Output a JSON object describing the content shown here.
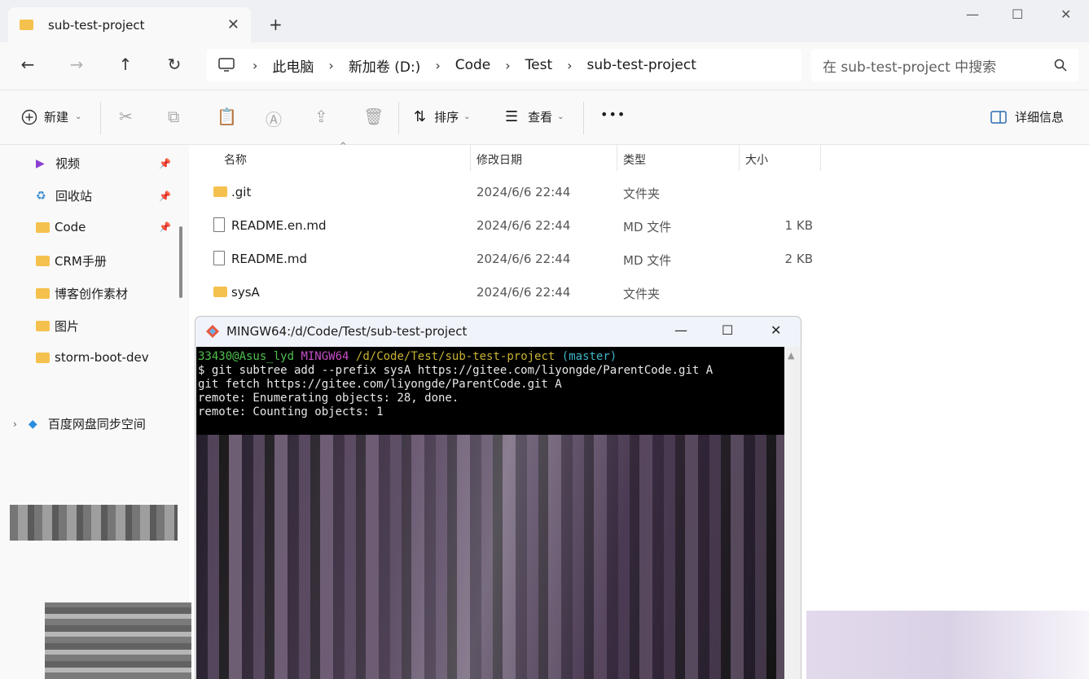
{
  "tab": {
    "title": "sub-test-project",
    "close": "✕"
  },
  "new_tab": "+",
  "window_controls": {
    "minimize": "—",
    "maximize": "☐",
    "close": "✕"
  },
  "nav": {
    "back": "←",
    "forward": "→",
    "up": "↑",
    "refresh": "↻"
  },
  "breadcrumb": [
    "此电脑",
    "新加卷 (D:)",
    "Code",
    "Test",
    "sub-test-project"
  ],
  "search": {
    "placeholder": "在 sub-test-project 中搜索"
  },
  "toolbar": {
    "new_label": "新建",
    "sort_label": "排序",
    "view_label": "查看",
    "more_label": "•••",
    "details_label": "详细信息"
  },
  "sidebar": {
    "items": [
      {
        "label": "视频",
        "pinned": true
      },
      {
        "label": "回收站",
        "pinned": true
      },
      {
        "label": "Code",
        "pinned": true
      },
      {
        "label": "CRM手册",
        "pinned": false
      },
      {
        "label": "博客创作素材",
        "pinned": false
      },
      {
        "label": "图片",
        "pinned": false
      },
      {
        "label": "storm-boot-dev",
        "pinned": false
      }
    ],
    "cloud_item": "百度网盘同步空间"
  },
  "columns": {
    "name": "名称",
    "modified": "修改日期",
    "type": "类型",
    "size": "大小"
  },
  "files": [
    {
      "name": ".git",
      "modified": "2024/6/6 22:44",
      "type": "文件夹",
      "size": "",
      "kind": "folder"
    },
    {
      "name": "README.en.md",
      "modified": "2024/6/6 22:44",
      "type": "MD 文件",
      "size": "1 KB",
      "kind": "file"
    },
    {
      "name": "README.md",
      "modified": "2024/6/6 22:44",
      "type": "MD 文件",
      "size": "2 KB",
      "kind": "file"
    },
    {
      "name": "sysA",
      "modified": "2024/6/6 22:44",
      "type": "文件夹",
      "size": "",
      "kind": "folder"
    }
  ],
  "terminal": {
    "title": "MINGW64:/d/Code/Test/sub-test-project",
    "prompt_user": "33430@Asus_lyd",
    "prompt_env": "MINGW64",
    "prompt_path": "/d/Code/Test/sub-test-project",
    "prompt_branch": "(master)",
    "lines": [
      "$ git subtree add --prefix sysA https://gitee.com/liyongde/ParentCode.git A",
      "git fetch https://gitee.com/liyongde/ParentCode.git A",
      "remote: Enumerating objects: 28, done.",
      "remote: Counting objects: 1"
    ]
  }
}
